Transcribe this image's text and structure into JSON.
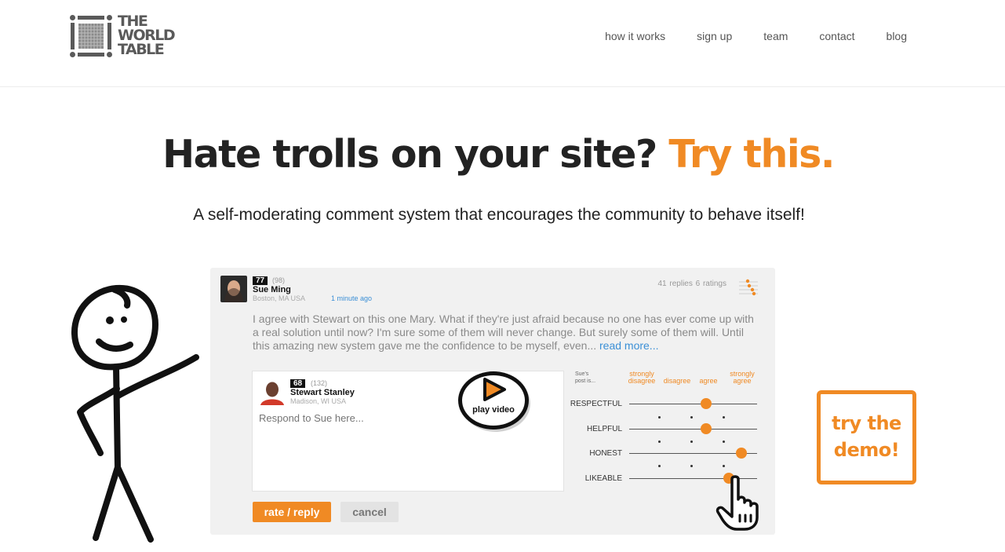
{
  "header": {
    "logo_lines": [
      "THE",
      "WORLD",
      "TABLE"
    ],
    "nav": [
      "how it works",
      "sign up",
      "team",
      "contact",
      "blog"
    ]
  },
  "hero": {
    "headline": "Hate trolls on your site?",
    "headline_accent": "Try this.",
    "subtitle": "A self-moderating comment system that encourages the community to behave itself!"
  },
  "demo_panel": {
    "post": {
      "score": "77",
      "count": "(98)",
      "name": "Sue Ming",
      "location": "Boston, MA   USA",
      "time": "1 minute ago",
      "stats": "41 replies   6 ratings",
      "text": "I agree with Stewart on this one Mary. What if they're just afraid because no one has ever come up with a real solution until now? I'm sure some of them will never change. But surely some of them will. Until this amazing new system gave me the confidence to be myself, even...",
      "read_more": "read more..."
    },
    "reply": {
      "score": "68",
      "count": "(132)",
      "name": "Stewart Stanley",
      "location": "Madison, WI   USA",
      "placeholder": "Respond to Sue here..."
    },
    "play_label": "play video",
    "rate_button": "rate / reply",
    "cancel_button": "cancel",
    "scale": {
      "intro": [
        "Sue's",
        "post is..."
      ],
      "headers": [
        {
          "lines": [
            "strongly",
            "disagree"
          ]
        },
        {
          "lines": [
            "",
            "disagree"
          ]
        },
        {
          "lines": [
            "",
            "agree"
          ]
        },
        {
          "lines": [
            "strongly",
            "agree"
          ]
        }
      ],
      "categories": [
        {
          "label": "RESPECTFUL",
          "value": 0.6
        },
        {
          "label": "HELPFUL",
          "value": 0.6
        },
        {
          "label": "HONEST",
          "value": 0.88
        },
        {
          "label": "LIKEABLE",
          "value": 0.78
        }
      ]
    }
  },
  "cta": {
    "lines": [
      "try the",
      "demo!"
    ]
  },
  "colors": {
    "accent": "#f08a24",
    "link": "#3b8fd6",
    "text": "#222222"
  }
}
